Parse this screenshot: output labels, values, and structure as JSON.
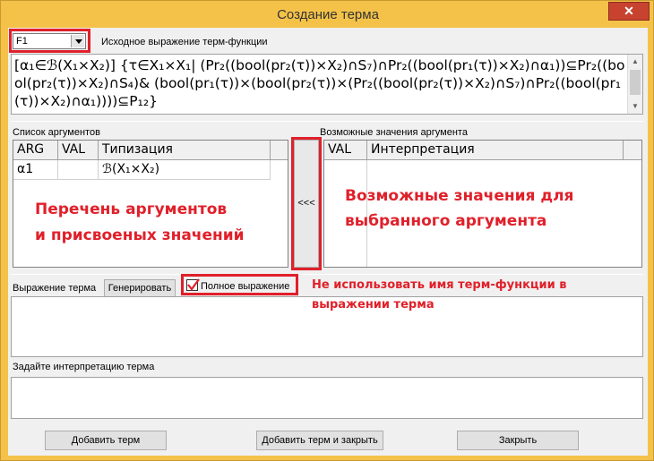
{
  "window": {
    "title": "Создание терма",
    "close_glyph": "✕"
  },
  "function_select": {
    "value": "F1"
  },
  "source_expression": {
    "label": "Исходное выражение терм-функции",
    "text": "[α₁∈ℬ(X₁×X₂)] {τ∈X₁×X₁| (Pr₂((bool(pr₂(τ))×X₂)∩S₇)∩Pr₂((bool(pr₁(τ))×X₂)∩α₁))⊆Pr₂((bool(pr₂(τ))×X₂)∩S₄)& (bool(pr₁(τ))×(bool(pr₂(τ))×(Pr₂((bool(pr₂(τ))×X₂)∩S₇)∩Pr₂((bool(pr₁(τ))×X₂)∩α₁))))⊆P₁₂}"
  },
  "arguments": {
    "label": "Список аргументов",
    "columns": [
      "ARG",
      "VAL",
      "Типизация"
    ],
    "rows": [
      {
        "arg": "α1",
        "val": "",
        "type": "ℬ(X₁×X₂)"
      }
    ]
  },
  "possible_values": {
    "label": "Возможные значения аргумента",
    "columns": [
      "VAL",
      "Интерпретация"
    ]
  },
  "move_button": {
    "label": "<<<"
  },
  "term_expression": {
    "label": "Выражение терма",
    "generate_label": "Генерировать",
    "full_expression_label": "Полное выражение",
    "full_expression_checked": true,
    "value": ""
  },
  "interpretation": {
    "label": "Задайте интерпретацию терма",
    "value": ""
  },
  "buttons": {
    "add_term": "Добавить терм",
    "add_and_close": "Добавить терм и закрыть",
    "close": "Закрыть"
  },
  "annotations": {
    "args_line1": "Перечень аргументов",
    "args_line2": "и присвоеных значений",
    "values_line1": "Возможные значения для",
    "values_line2": "выбранного аргумента",
    "checkbox_line1": "Не использовать имя терм-функции в",
    "checkbox_line2": "выражении терма"
  },
  "colors": {
    "annotation_red": "#e0202a",
    "title_bar": "#f4c249"
  }
}
